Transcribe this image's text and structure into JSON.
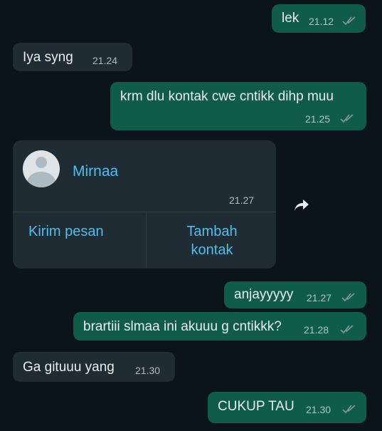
{
  "messages": [
    {
      "text": "lek",
      "time": "21.12",
      "direction": "out",
      "read": true
    },
    {
      "text": "Iya syng",
      "time": "21.24",
      "direction": "in"
    },
    {
      "text": "krm dlu kontak cwe cntikk dihp muu",
      "time": "21.25",
      "direction": "out",
      "read": true
    },
    {
      "text": "anjayyyyy",
      "time": "21.27",
      "direction": "out",
      "read": true
    },
    {
      "text": "brartiii slmaa ini akuuu g cntikkk?",
      "time": "21.28",
      "direction": "out",
      "read": true
    },
    {
      "text": "Ga gituuu yang",
      "time": "21.30",
      "direction": "in"
    },
    {
      "text": "CUKUP TAU",
      "time": "21.30",
      "direction": "out",
      "read": true
    }
  ],
  "contact_card": {
    "name": "Mirnaa",
    "time": "21.27",
    "action_message": "Kirim pesan",
    "action_add": "Tambah kontak",
    "forward_icon": "share-forward-icon"
  },
  "colors": {
    "background": "#0b141a",
    "outgoing_bubble": "#0f5c4a",
    "incoming_bubble": "#1f2c33",
    "link": "#53bdeb",
    "read_ticks": "#8696a0"
  }
}
